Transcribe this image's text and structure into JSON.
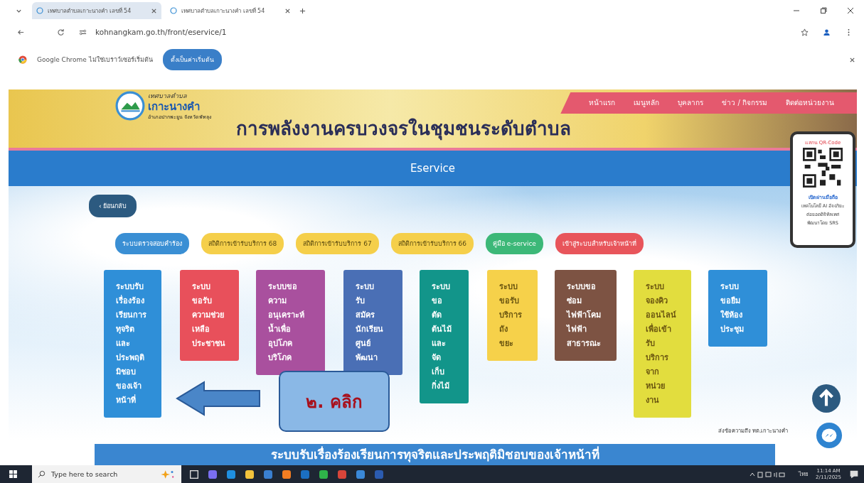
{
  "browser": {
    "tabs": [
      {
        "title": "เทศบาลตำบลเกาะนางคำ เลขที่ 54",
        "selected": true
      },
      {
        "title": "เทศบาลตำบลเกาะนางคำ เลขที่ 54",
        "selected": false
      }
    ],
    "address": "kohnangkam.go.th/front/eservice/1",
    "infobar": {
      "message": "Google Chrome ไม่ใช่เบราว์เซอร์เริ่มต้น",
      "button": "ตั้งเป็นค่าเริ่มต้น"
    }
  },
  "header": {
    "org_small": "เทศบาลตำบล",
    "org_name": "เกาะนางคำ",
    "org_place": "อำเภอปากพะยูน จังหวัดพัทลุง",
    "banner_text": "การพลังงานครบวงจรในชุมชนระดับตำบล",
    "nav": [
      "หน้าแรก",
      "เมนูหลัก",
      "บุคลากร",
      "ข่าว / กิจกรรม",
      "ติดต่อหน่วยงาน"
    ]
  },
  "page_title": "Eservice",
  "back_button": "‹ ย้อนกลับ",
  "pills": [
    {
      "label": "ระบบตรวจสอบคำร้อง",
      "color": "#3a8fd4"
    },
    {
      "label": "สถิติการเข้ารับบริการ 68",
      "color": "#f5cf4a"
    },
    {
      "label": "สถิติการเข้ารับบริการ 67",
      "color": "#f5cf4a"
    },
    {
      "label": "สถิติการเข้ารับบริการ 66",
      "color": "#f5cf4a"
    },
    {
      "label": "คู่มือ e-service",
      "color": "#3cb878"
    },
    {
      "label": "เข้าสู่ระบบสำหรับเจ้าหน้าที่",
      "color": "#e8555b"
    }
  ],
  "cards": [
    {
      "text": "ระบบรับ\nเรื่องร้อง\nเรียนการ\nทุจริต\nและ\nประพฤติ\nมิชอบ\nของเจ้า\nหน้าที่",
      "color": "#2f8fd8"
    },
    {
      "text": "ระบบ\nขอรับ\nความช่วย\nเหลือ\nประชาชน",
      "color": "#e8505b"
    },
    {
      "text": "ระบบขอ\nความ\nอนุเคราะห์\nน้ำเพื่อ\nอุปโภค\nบริโภค",
      "color": "#a9509e"
    },
    {
      "text": "ระบบ\nรับ\nสมัคร\nนักเรียน\nศูนย์\nพัฒนา",
      "color": "#4a6fb5"
    },
    {
      "text": "ระบบ\nขอ\nตัด\nต้นไม้\nและ\nจัด\nเก็บ\nกิ่งไม้",
      "color": "#12958a"
    },
    {
      "text": "ระบบ\nขอรับ\nบริการ\nถัง\nขยะ",
      "color": "#f6d14a"
    },
    {
      "text": "ระบบขอ\nซ่อม\nไฟฟ้าโคม\nไฟฟ้า\nสาธารณะ",
      "color": "#7d5343"
    },
    {
      "text": "ระบบ\nจองคิว\nออนไลน์\nเพื่อเข้า\nรับ\nบริการ\nจาก\nหน่วย\nงาน",
      "color": "#e2dd3e"
    },
    {
      "text": "ระบบ\nขอยืม\nใช้ห้อง\nประชุม",
      "color": "#2f8fd8"
    }
  ],
  "callout": "๒. คลิก",
  "qr": {
    "title": "แสกน QR-Code",
    "subtitle": "เปิดผ่านมือถือ",
    "lines": [
      "เทคโนโลยี AI อัจฉริยะ",
      "ต่อยอดดิจิทัลเทศ",
      "พัฒนาโดย SRS"
    ]
  },
  "message_label": "ส่งข้อความถึง ทต.เกาะนางคำ",
  "section_heading": "ระบบรับเรื่องร้องเรียนการทุจริตและประพฤติมิชอบของเจ้าหน้าที่",
  "taskbar": {
    "search_placeholder": "Type here to search",
    "language": "ไทย",
    "time": "11:14 AM",
    "date": "2/11/2025"
  }
}
